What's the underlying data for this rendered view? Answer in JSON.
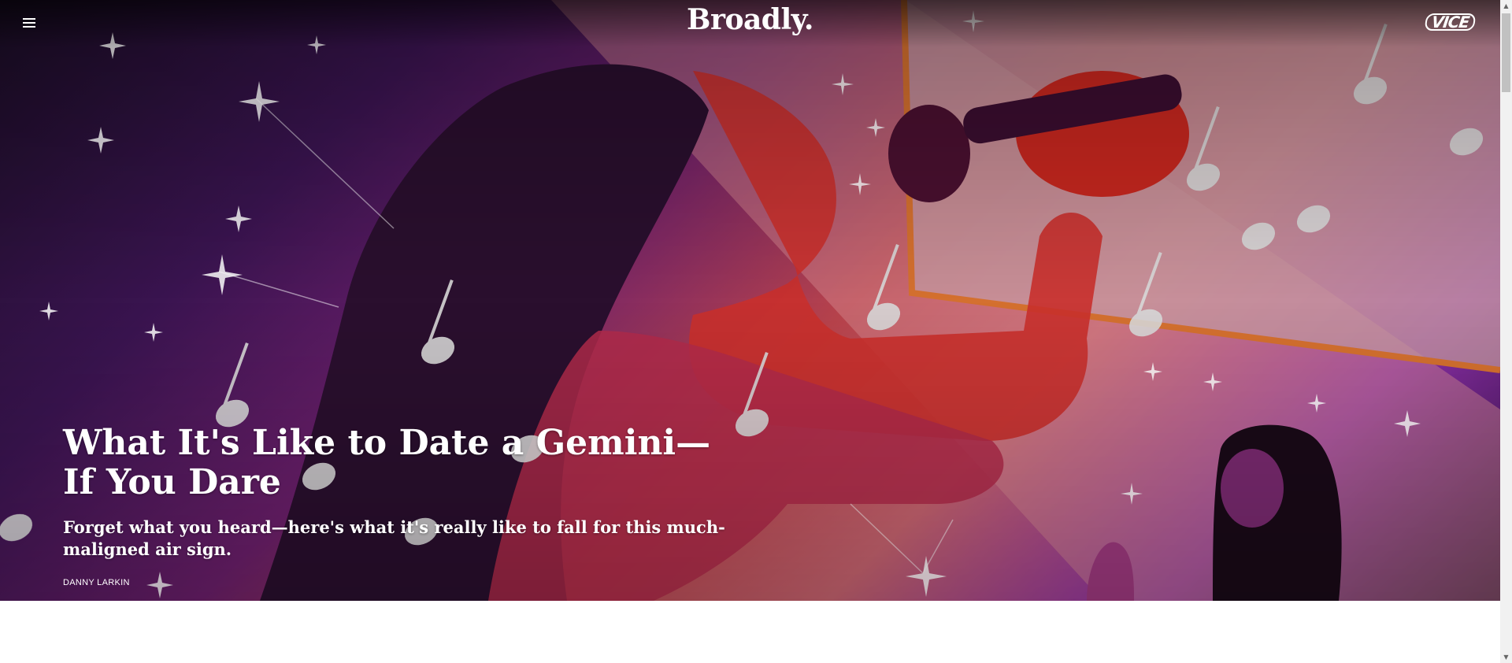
{
  "header": {
    "brand": "Broadly.",
    "network_logo": "VICE",
    "menu_icon": "hamburger-menu-icon"
  },
  "article": {
    "headline": "What It's Like to Date a Gemini—If You Dare",
    "dek": "Forget what you heard—here's what it's really like to fall for this much-maligned air sign.",
    "author": "DANNY LARKIN"
  },
  "hero_image": {
    "subject": "illustration-singer-with-microphone-and-music-notes"
  },
  "colors": {
    "hero_dark": "#1a0d24",
    "hero_purple": "#6b1f6b",
    "hero_red": "#b8434c",
    "hero_pink": "#c86470",
    "hero_violet": "#8c2fa8",
    "text": "#ffffff"
  }
}
